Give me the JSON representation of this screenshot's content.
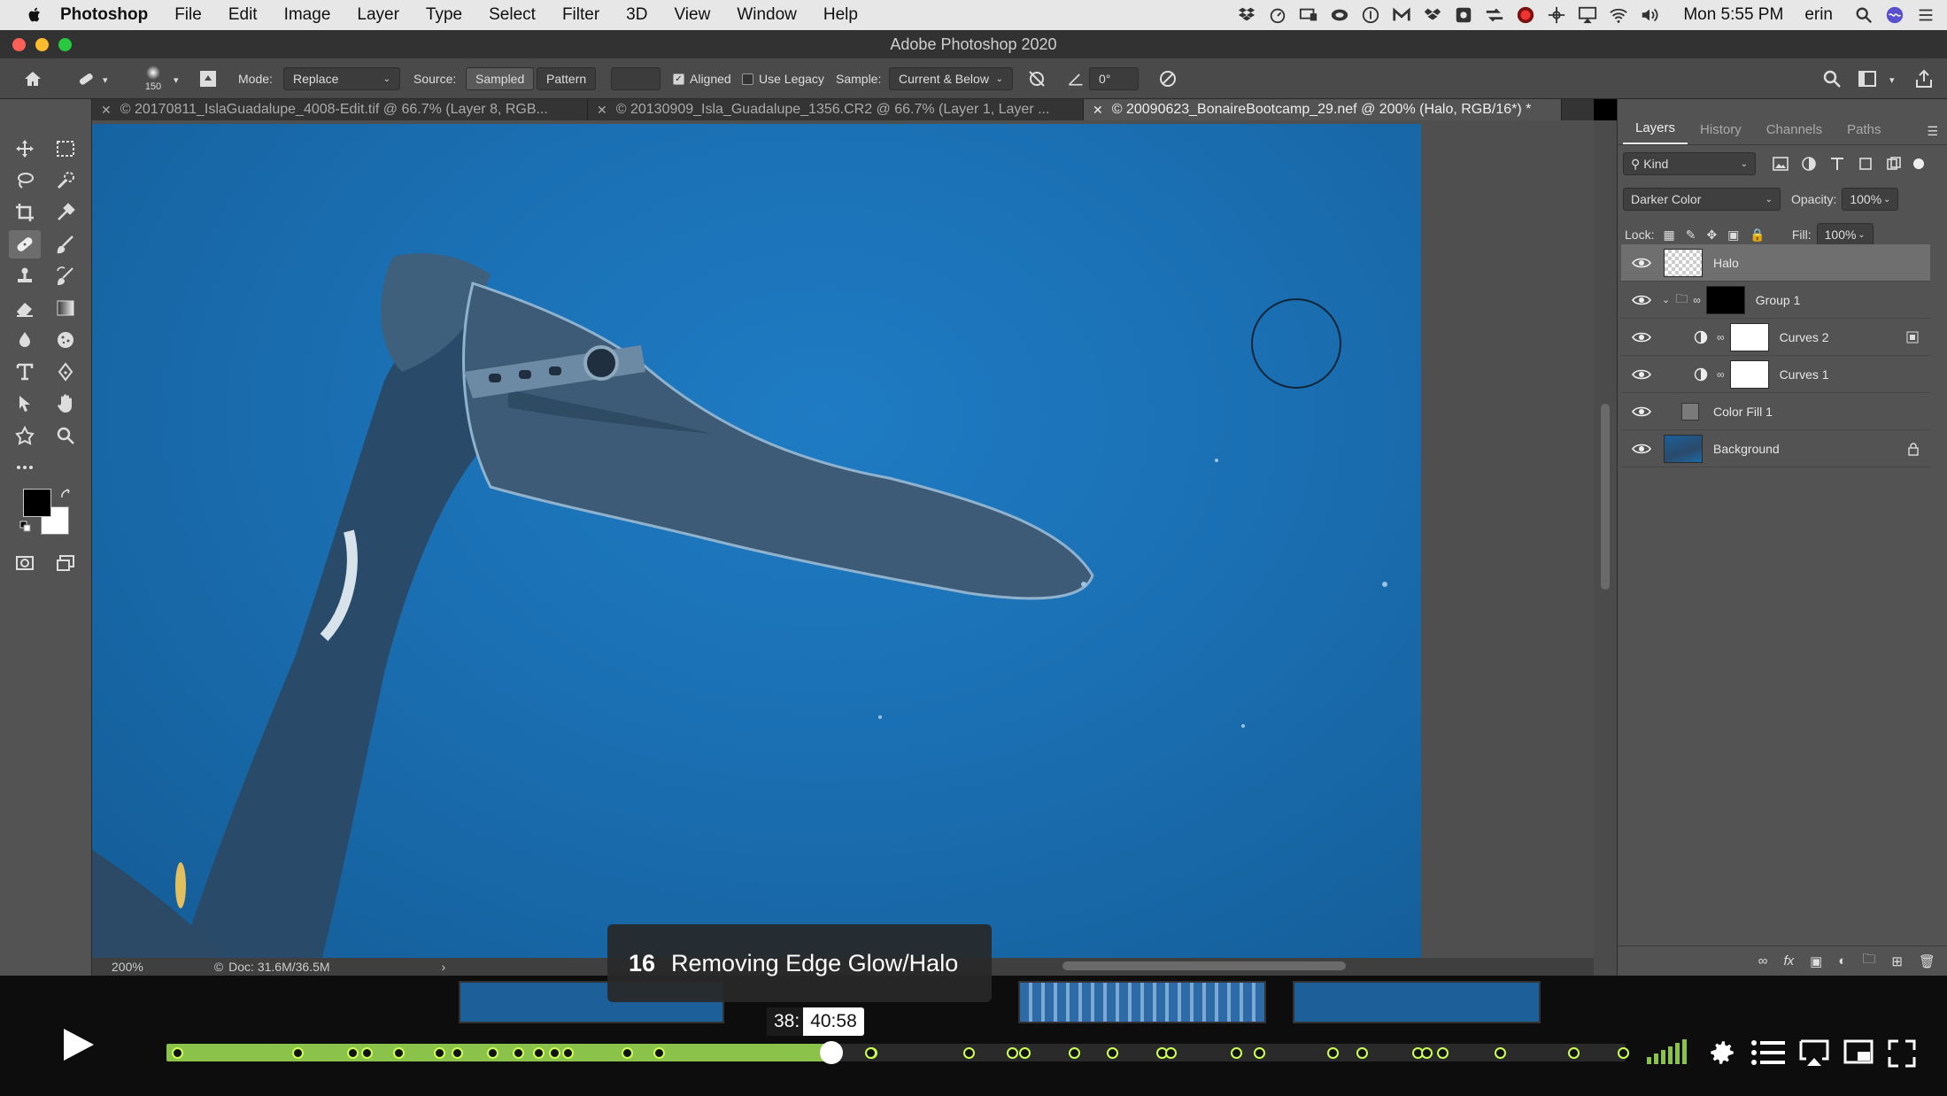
{
  "menubar": {
    "app": "Photoshop",
    "items": [
      "File",
      "Edit",
      "Image",
      "Layer",
      "Type",
      "Select",
      "Filter",
      "3D",
      "View",
      "Window",
      "Help"
    ],
    "clock": "Mon 5:55 PM",
    "user": "erin"
  },
  "window": {
    "title": "Adobe Photoshop 2020"
  },
  "options": {
    "brush_size": "150",
    "mode_label": "Mode:",
    "mode_value": "Replace",
    "source_label": "Source:",
    "source_sampled": "Sampled",
    "source_pattern": "Pattern",
    "aligned": "Aligned",
    "use_legacy": "Use Legacy",
    "sample_label": "Sample:",
    "sample_value": "Current & Below",
    "angle_value": "0°"
  },
  "tabs": [
    {
      "label": "© 20170811_IslaGuadalupe_4008-Edit.tif @ 66.7% (Layer 8, RGB..."
    },
    {
      "label": "© 20130909_Isla_Guadalupe_1356.CR2 @ 66.7% (Layer 1, Layer ..."
    },
    {
      "label": "© 20090623_BonaireBootcamp_29.nef @ 200% (Halo, RGB/16*) *"
    }
  ],
  "status": {
    "zoom": "200%",
    "doc": "Doc: 31.6M/36.5M"
  },
  "panel": {
    "tabs": [
      "Layers",
      "History",
      "Channels",
      "Paths"
    ],
    "kind": "Kind",
    "blend_mode": "Darker Color",
    "opacity_label": "Opacity:",
    "opacity_value": "100%",
    "lock_label": "Lock:",
    "fill_label": "Fill:",
    "fill_value": "100%",
    "layers": [
      {
        "name": "Halo"
      },
      {
        "name": "Group 1"
      },
      {
        "name": "Curves 2"
      },
      {
        "name": "Curves 1"
      },
      {
        "name": "Color Fill 1"
      },
      {
        "name": "Background"
      }
    ]
  },
  "player": {
    "chapter_number": "16",
    "chapter_title": "Removing Edge Glow/Halo",
    "time_a": "38:",
    "time_b": "40:58",
    "progress": 0.4557
  },
  "colors": {
    "accent": "#8bc34a",
    "canvas": "#1a6fb2"
  }
}
